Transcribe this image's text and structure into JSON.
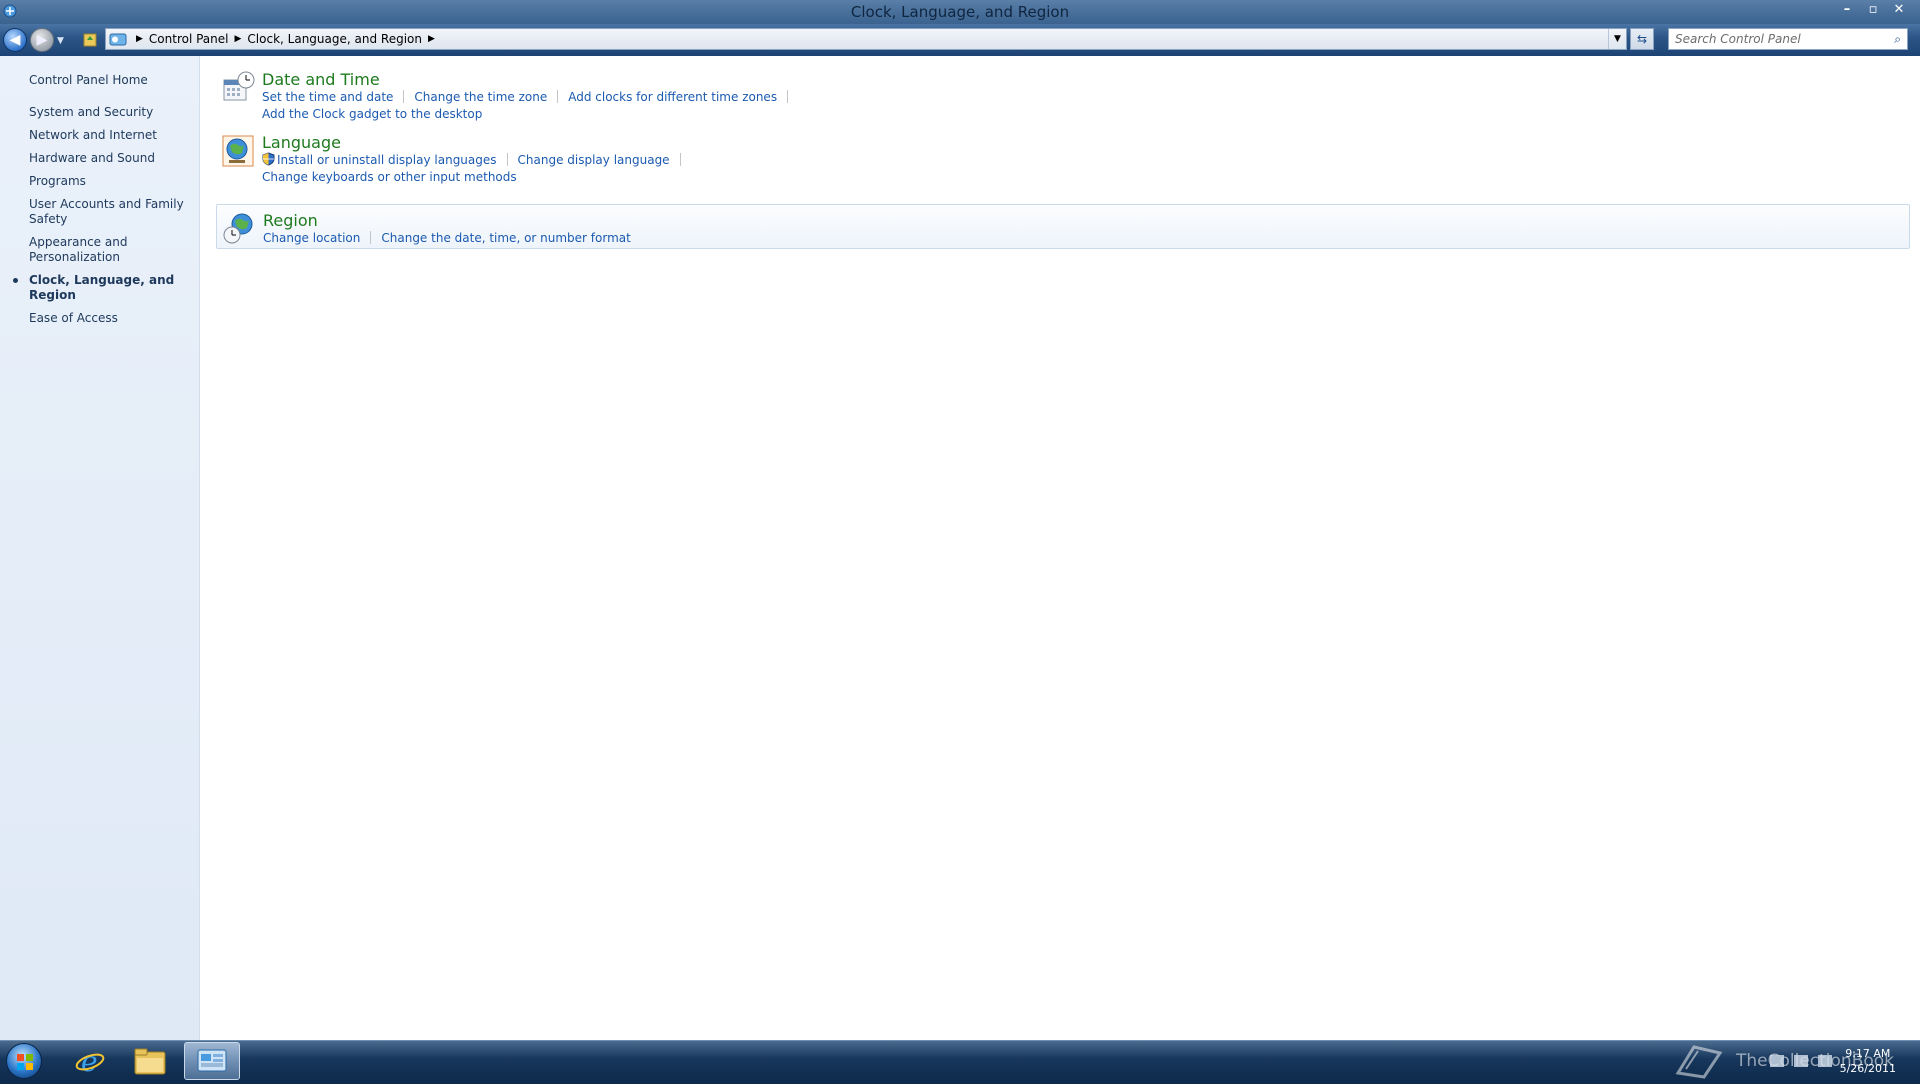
{
  "window": {
    "title": "Clock, Language, and Region",
    "controls": {
      "minimize": "–",
      "maximize": "▫",
      "close": "✕"
    }
  },
  "navbar": {
    "breadcrumbs": [
      "Control Panel",
      "Clock, Language, and Region"
    ],
    "search_placeholder": "Search Control Panel"
  },
  "sidebar": {
    "home": "Control Panel Home",
    "items": [
      {
        "label": "System and Security",
        "active": false
      },
      {
        "label": "Network and Internet",
        "active": false
      },
      {
        "label": "Hardware and Sound",
        "active": false
      },
      {
        "label": "Programs",
        "active": false
      },
      {
        "label": "User Accounts and Family Safety",
        "active": false
      },
      {
        "label": "Appearance and Personalization",
        "active": false
      },
      {
        "label": "Clock, Language, and Region",
        "active": true
      },
      {
        "label": "Ease of Access",
        "active": false
      }
    ]
  },
  "categories": [
    {
      "title": "Date and Time",
      "icon": "calendar-clock-icon",
      "links": [
        "Set the time and date",
        "Change the time zone",
        "Add clocks for different time zones",
        "Add the Clock gadget to the desktop"
      ]
    },
    {
      "title": "Language",
      "icon": "globe-language-icon",
      "links": [
        "Install or uninstall display languages",
        "Change display language",
        "Change keyboards or other input methods"
      ]
    },
    {
      "title": "Region",
      "icon": "globe-clock-icon",
      "links": [
        "Change location",
        "Change the date, time, or number format"
      ]
    }
  ],
  "taskbar": {
    "apps": [
      "internet-explorer-icon",
      "file-explorer-icon",
      "control-panel-icon"
    ],
    "active_app": "control-panel-icon",
    "watermark": "TheCollectionBook",
    "clock": {
      "time": "9:17 AM",
      "date": "5/26/2011"
    }
  },
  "colors": {
    "link": "#1c5ab0",
    "category_title": "#1e7a1e",
    "sidebar_text": "#1e395b"
  }
}
